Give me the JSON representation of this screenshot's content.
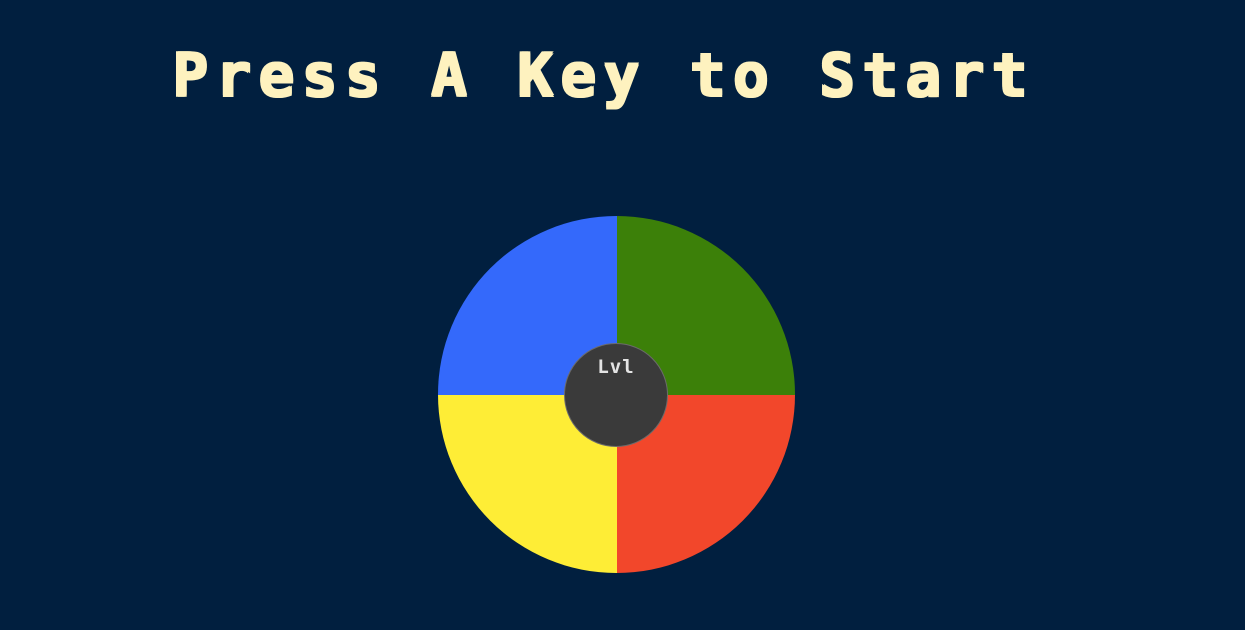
{
  "title": "Press A Key to Start",
  "level_label": "Lvl",
  "colors": {
    "background": "#011F3F",
    "title": "#FEF2BF",
    "green": "#3C8009",
    "red": "#F2472B",
    "yellow": "#FEED36",
    "blue": "#3469FB",
    "center": "#3A3A3A"
  },
  "buttons": [
    {
      "id": "green"
    },
    {
      "id": "red"
    },
    {
      "id": "yellow"
    },
    {
      "id": "blue"
    }
  ]
}
